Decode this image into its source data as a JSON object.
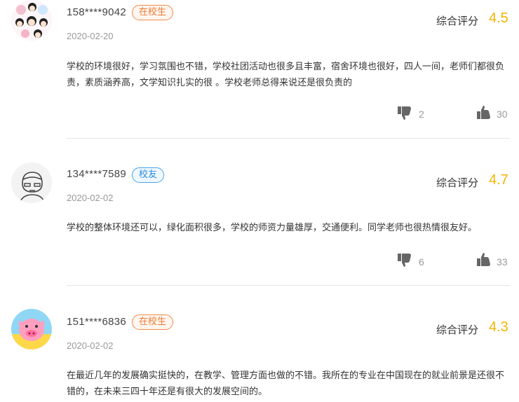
{
  "reviews": [
    {
      "username": "158****9042",
      "badge": "在校生",
      "badge_type": "student",
      "date": "2020-02-20",
      "score_label": "综合评分",
      "score": "4.5",
      "content": "学校的环境很好，学习氛围也不错，学校社团活动也很多且丰富，宿舍环境也很好，四人一间，老师们都很负责，素质涵养高，文学知识扎实的很 。学校老师总得来说还是很负责的",
      "dislikes": "2",
      "likes": "30"
    },
    {
      "username": "134****7589",
      "badge": "校友",
      "badge_type": "alumni",
      "date": "2020-02-02",
      "score_label": "综合评分",
      "score": "4.7",
      "content": "学校的整体环境还可以，绿化面积很多，学校的师资力量雄厚，交通便利。同学老师也很热情很友好。",
      "dislikes": "6",
      "likes": "33"
    },
    {
      "username": "151****6836",
      "badge": "在校生",
      "badge_type": "student",
      "date": "2020-02-02",
      "score_label": "综合评分",
      "score": "4.3",
      "content": "在最近几年的发展确实挺快的，在教学、管理方面也做的不错。我所在的专业在中国现在的就业前景是还很不错的，在未来三四十年还是有很大的发展空间的。"
    }
  ],
  "colors": {
    "score": "#f5b400",
    "student_badge": "#f07a30",
    "alumni_badge": "#2a8ee0"
  }
}
